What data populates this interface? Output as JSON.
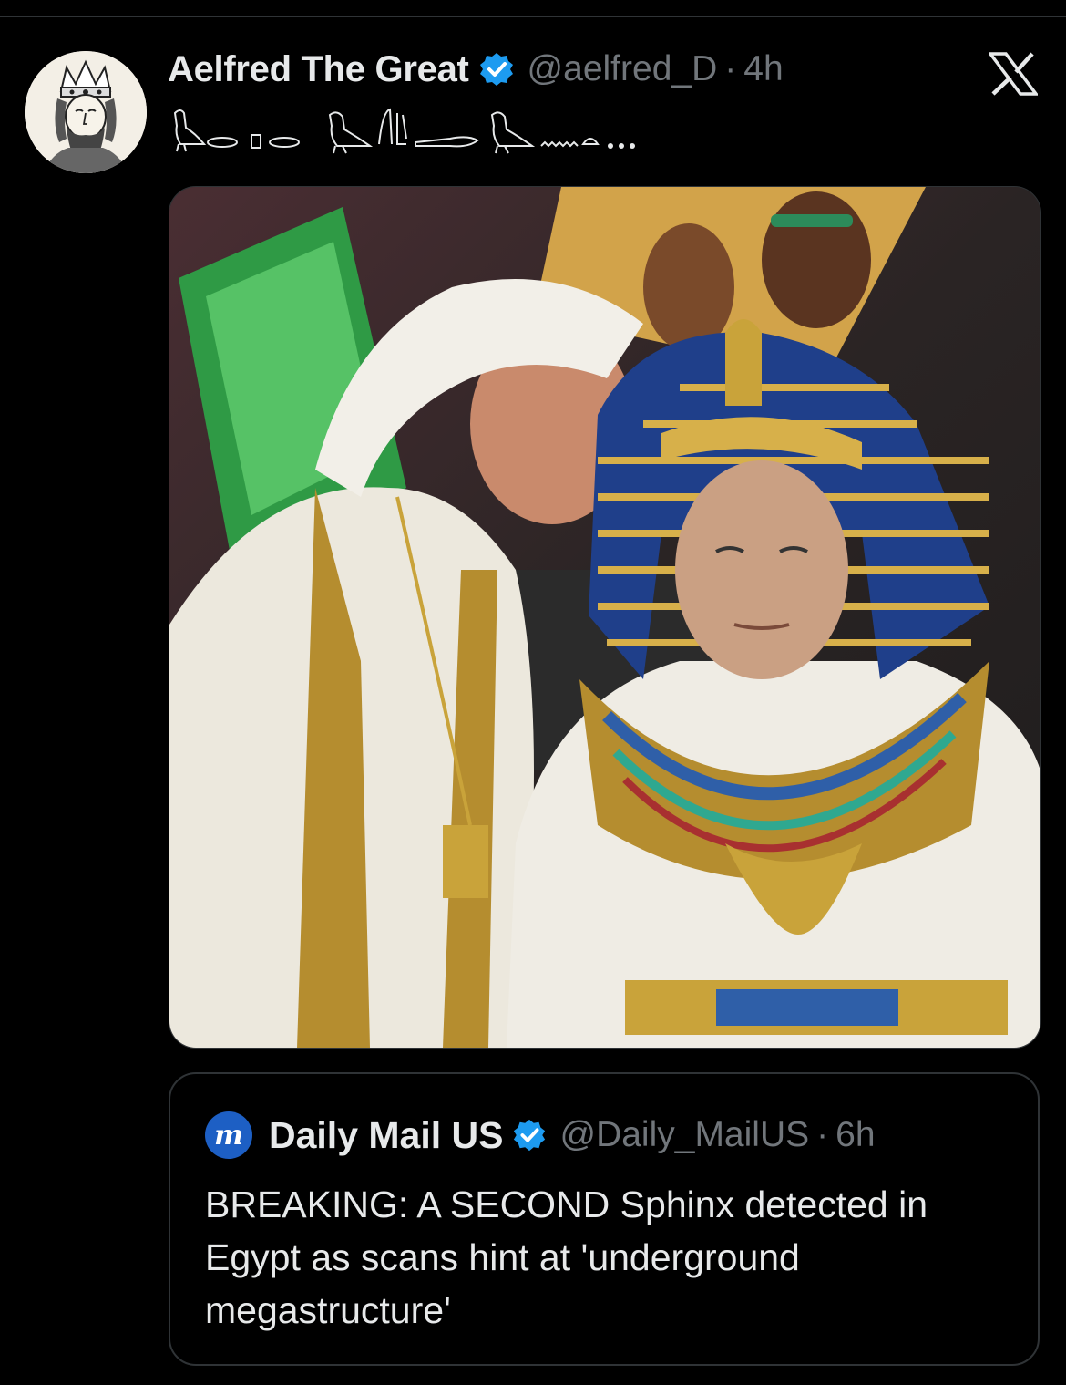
{
  "tweet": {
    "display_name": "Aelfred The Great",
    "handle": "@aelfred_D",
    "separator": "·",
    "time": "4h",
    "body_text": "𓅂𓂋𓏏𓂋𓅃𓆓𓂧𓅂𓈖𓏏...",
    "avatar_icon": "king-portrait-avatar",
    "verified_color": "#1d9bf0"
  },
  "brand": {
    "logo_icon": "x-logo-icon"
  },
  "quote": {
    "display_name": "Daily Mail US",
    "handle": "@Daily_MailUS",
    "separator": "·",
    "time": "6h",
    "avatar_letter": "m",
    "text": "BREAKING: A SECOND Sphinx detected in Egypt as scans hint at 'underground megastructure'"
  },
  "colors": {
    "background": "#000000",
    "primary_text": "#e7e9ea",
    "secondary_text": "#71767b",
    "border": "#2f3336",
    "verified": "#1d9bf0"
  }
}
